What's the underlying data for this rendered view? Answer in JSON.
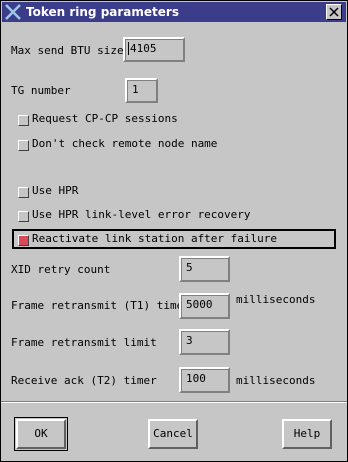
{
  "window": {
    "title": "Token ring parameters"
  },
  "fields": {
    "max_send_btu": {
      "label": "Max send BTU size",
      "value": "4105"
    },
    "tg_number": {
      "label": "TG number",
      "value": "1"
    },
    "xid_retry": {
      "label": "XID retry count",
      "value": "5"
    },
    "t1_timer": {
      "label": "Frame retransmit (T1) timer",
      "value": "5000",
      "unit": "milliseconds"
    },
    "retransmit_limit": {
      "label": "Frame retransmit limit",
      "value": "3"
    },
    "t2_timer": {
      "label": "Receive ack (T2) timer",
      "value": "100",
      "unit": "milliseconds"
    }
  },
  "checkboxes": {
    "cp_cp": {
      "label": "Request CP-CP sessions",
      "checked": false
    },
    "remote_node": {
      "label": "Don't check remote node name",
      "checked": false
    },
    "use_hpr": {
      "label": "Use HPR",
      "checked": false
    },
    "hpr_link": {
      "label": "Use HPR link-level error recovery",
      "checked": false
    },
    "reactivate": {
      "label": "Reactivate link station after failure",
      "checked": true
    }
  },
  "buttons": {
    "ok": "OK",
    "cancel": "Cancel",
    "help": "Help"
  },
  "colors": {
    "titlebar": "#3b3d8a",
    "checked": "#d84a5a",
    "background": "#c6c6c6"
  }
}
